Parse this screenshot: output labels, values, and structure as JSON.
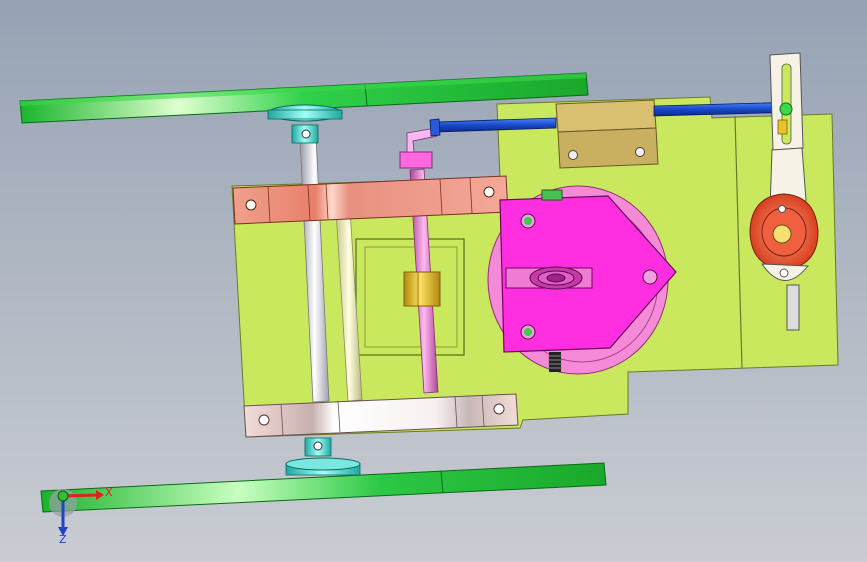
{
  "viewport": {
    "background_top": "#96a2b4",
    "background_bottom": "#c9ccd2"
  },
  "triad": {
    "x_label": "X",
    "z_label": "Z",
    "x_color": "#e02020",
    "y_color": "#20b020",
    "z_color": "#2040d0"
  },
  "colors": {
    "track": "#22c23a",
    "base_plate": "#c8e85e",
    "bracket_top": "#f0a090",
    "bracket_bottom": "#f2e8e8",
    "gear_disc": "#f08ad6",
    "cam_block": "#ff2ee0",
    "blue_rod": "#1a5ad8",
    "tan_block": "#c8b060",
    "flange": "#e85a3a",
    "slider_arm": "#f6f2e6",
    "bushing_yellow": "#e8c02a",
    "pink_rod": "#e070c8",
    "bearing_cyan": "#34c8c0"
  },
  "icons": [
    "gear-icon",
    "bolt-icon",
    "pulley-icon"
  ]
}
